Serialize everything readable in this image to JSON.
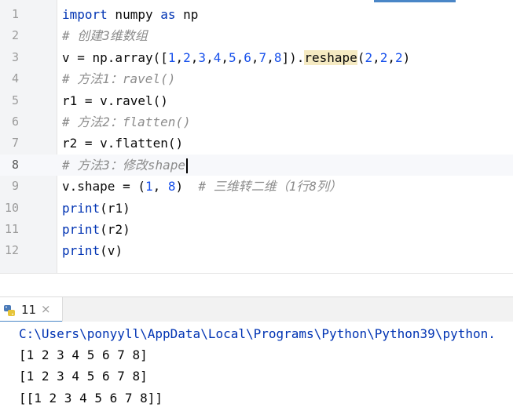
{
  "editor": {
    "current_line": 8,
    "lines": [
      {
        "num": "1",
        "parts": [
          {
            "t": "import",
            "c": "kw"
          },
          {
            "t": " numpy ",
            "c": ""
          },
          {
            "t": "as",
            "c": "kw"
          },
          {
            "t": " np",
            "c": ""
          }
        ]
      },
      {
        "num": "2",
        "parts": [
          {
            "t": "# 创建3维数组",
            "c": "cmt"
          }
        ]
      },
      {
        "num": "3",
        "parts": [
          {
            "t": "v = np.array([",
            "c": ""
          },
          {
            "t": "1",
            "c": "num"
          },
          {
            "t": ",",
            "c": ""
          },
          {
            "t": "2",
            "c": "num"
          },
          {
            "t": ",",
            "c": ""
          },
          {
            "t": "3",
            "c": "num"
          },
          {
            "t": ",",
            "c": ""
          },
          {
            "t": "4",
            "c": "num"
          },
          {
            "t": ",",
            "c": ""
          },
          {
            "t": "5",
            "c": "num"
          },
          {
            "t": ",",
            "c": ""
          },
          {
            "t": "6",
            "c": "num"
          },
          {
            "t": ",",
            "c": ""
          },
          {
            "t": "7",
            "c": "num"
          },
          {
            "t": ",",
            "c": ""
          },
          {
            "t": "8",
            "c": "num"
          },
          {
            "t": "]).",
            "c": ""
          },
          {
            "t": "reshape",
            "c": "hl"
          },
          {
            "t": "(",
            "c": ""
          },
          {
            "t": "2",
            "c": "num"
          },
          {
            "t": ",",
            "c": ""
          },
          {
            "t": "2",
            "c": "num"
          },
          {
            "t": ",",
            "c": ""
          },
          {
            "t": "2",
            "c": "num"
          },
          {
            "t": ")",
            "c": ""
          }
        ]
      },
      {
        "num": "4",
        "parts": [
          {
            "t": "# 方法1：ravel()",
            "c": "cmt"
          }
        ]
      },
      {
        "num": "5",
        "parts": [
          {
            "t": "r1 = v.ravel()",
            "c": ""
          }
        ]
      },
      {
        "num": "6",
        "parts": [
          {
            "t": "# 方法2：flatten()",
            "c": "cmt"
          }
        ]
      },
      {
        "num": "7",
        "parts": [
          {
            "t": "r2 = v.flatten()",
            "c": ""
          }
        ]
      },
      {
        "num": "8",
        "parts": [
          {
            "t": "# 方法3：修改shape",
            "c": "cmt"
          }
        ]
      },
      {
        "num": "9",
        "parts": [
          {
            "t": "v.shape = (",
            "c": ""
          },
          {
            "t": "1",
            "c": "num"
          },
          {
            "t": ", ",
            "c": ""
          },
          {
            "t": "8",
            "c": "num"
          },
          {
            "t": ")  ",
            "c": ""
          },
          {
            "t": "# 三维转二维（1行8列）",
            "c": "cmt"
          }
        ]
      },
      {
        "num": "10",
        "parts": [
          {
            "t": "print",
            "c": "kw"
          },
          {
            "t": "(r1)",
            "c": ""
          }
        ]
      },
      {
        "num": "11",
        "parts": [
          {
            "t": "print",
            "c": "kw"
          },
          {
            "t": "(r2)",
            "c": ""
          }
        ]
      },
      {
        "num": "12",
        "parts": [
          {
            "t": "print",
            "c": "kw"
          },
          {
            "t": "(v)",
            "c": ""
          }
        ]
      }
    ]
  },
  "run_panel": {
    "tab_label": "11",
    "tab_icon": "python-icon",
    "close_glyph": "×",
    "command": "C:\\Users\\ponyyll\\AppData\\Local\\Programs\\Python\\Python39\\python.",
    "output": [
      "[1 2 3 4 5 6 7 8]",
      "[1 2 3 4 5 6 7 8]",
      "[[1 2 3 4 5 6 7 8]]"
    ]
  }
}
